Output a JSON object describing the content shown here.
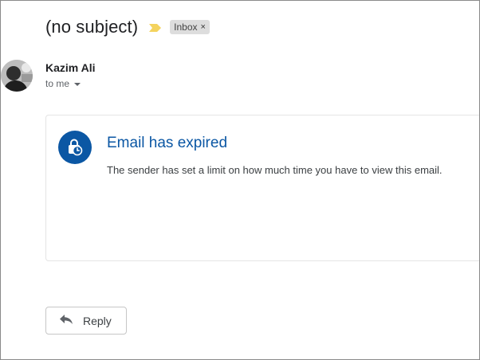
{
  "email": {
    "subject": "(no subject)",
    "importance_icon": "importance-marker-icon",
    "label_chip": {
      "label": "Inbox",
      "remove_symbol": "×"
    },
    "colors": {
      "importance": "#f4d35e",
      "accent": "#0b57a4",
      "chip_bg": "#dddddd"
    }
  },
  "sender": {
    "name": "Kazim Ali",
    "recipient_text": "to me",
    "details_icon": "caret-down-icon"
  },
  "expired_card": {
    "icon": "lock-clock-icon",
    "title": "Email has expired",
    "message": "The sender has set a limit on how much time you have to view this email."
  },
  "actions": {
    "reply_label": "Reply",
    "reply_icon": "reply-arrow-icon"
  }
}
